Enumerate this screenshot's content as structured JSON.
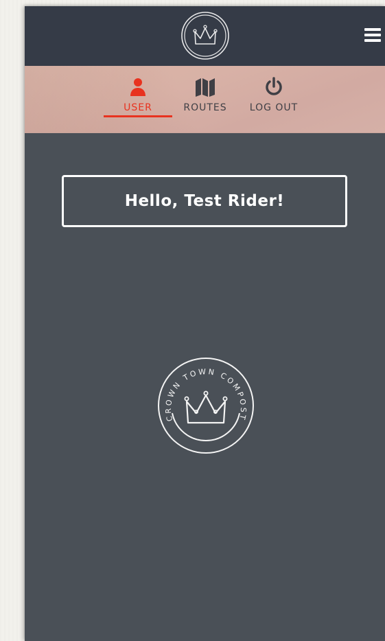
{
  "header": {
    "logo_icon": "crown-icon",
    "menu_icon": "hamburger-menu-icon"
  },
  "nav": {
    "items": [
      {
        "label": "USER",
        "icon": "user-icon",
        "active": true
      },
      {
        "label": "ROUTES",
        "icon": "map-icon",
        "active": false
      },
      {
        "label": "LOG OUT",
        "icon": "power-icon",
        "active": false
      }
    ],
    "active_color": "#e8321f"
  },
  "greeting": {
    "text": "Hello, Test Rider!"
  },
  "brand_logo": {
    "text_top": "CROWN TOWN COMPOST"
  },
  "colors": {
    "header_bg": "#353b47",
    "body_bg": "#4a5057",
    "accent": "#e8321f"
  }
}
